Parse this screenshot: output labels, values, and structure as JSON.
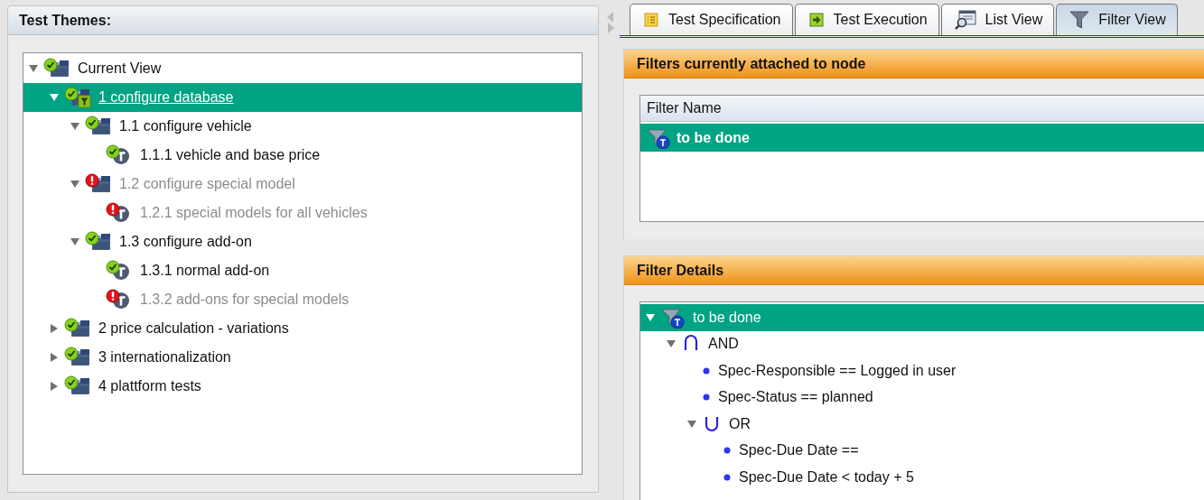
{
  "left_panel": {
    "title": "Test Themes:"
  },
  "theme_tree": [
    {
      "label": "Current View",
      "kind": "folder",
      "passed": true,
      "expanded": true,
      "selected": false,
      "disabled": false,
      "children": [
        {
          "label": "1 configure database",
          "kind": "filtered-folder",
          "passed": true,
          "expanded": true,
          "selected": true,
          "disabled": false,
          "children": [
            {
              "label": "1.1 configure vehicle",
              "kind": "folder",
              "passed": true,
              "expanded": true,
              "selected": false,
              "disabled": false,
              "children": [
                {
                  "label": "1.1.1 vehicle and base price",
                  "kind": "test",
                  "passed": true,
                  "selected": false,
                  "disabled": false
                }
              ]
            },
            {
              "label": "1.2 configure special model",
              "kind": "folder",
              "passed": false,
              "expanded": true,
              "selected": false,
              "disabled": true,
              "children": [
                {
                  "label": "1.2.1 special models for all vehicles",
                  "kind": "test",
                  "passed": false,
                  "selected": false,
                  "disabled": true
                }
              ]
            },
            {
              "label": "1.3 configure add-on",
              "kind": "folder",
              "passed": true,
              "expanded": true,
              "selected": false,
              "disabled": false,
              "children": [
                {
                  "label": "1.3.1 normal add-on",
                  "kind": "test",
                  "passed": true,
                  "selected": false,
                  "disabled": false
                },
                {
                  "label": "1.3.2 add-ons for special models",
                  "kind": "test",
                  "passed": false,
                  "selected": false,
                  "disabled": true
                }
              ]
            }
          ]
        },
        {
          "label": "2 price calculation - variations",
          "kind": "folder",
          "passed": true,
          "expanded": false,
          "selected": false,
          "disabled": false
        },
        {
          "label": "3 internationalization",
          "kind": "folder",
          "passed": true,
          "expanded": false,
          "selected": false,
          "disabled": false
        },
        {
          "label": "4 plattform tests",
          "kind": "folder",
          "passed": true,
          "expanded": false,
          "selected": false,
          "disabled": false
        }
      ]
    }
  ],
  "tabs": [
    {
      "label": "Test Specification",
      "kind": "list",
      "selected": false
    },
    {
      "label": "Test Execution",
      "kind": "execute",
      "selected": false
    },
    {
      "label": "List View",
      "kind": "search-window",
      "selected": false
    },
    {
      "label": "Filter View",
      "kind": "funnel",
      "selected": true
    }
  ],
  "attached_filters": {
    "title": "Filters currently attached to node",
    "columns": [
      "Filter Name"
    ],
    "rows": [
      {
        "name": "to be done",
        "selected": true
      }
    ]
  },
  "filter_details": {
    "title": "Filter Details",
    "tree": [
      {
        "label": "to be done",
        "kind": "filter",
        "expanded": true,
        "selected": true,
        "children": [
          {
            "label": "AND",
            "kind": "and",
            "expanded": true,
            "selected": false,
            "children": [
              {
                "label": "Spec-Responsible == Logged in user",
                "kind": "condition",
                "selected": false
              },
              {
                "label": "Spec-Status == planned",
                "kind": "condition",
                "selected": false
              },
              {
                "label": "OR",
                "kind": "or",
                "expanded": true,
                "selected": false,
                "children": [
                  {
                    "label": "Spec-Due Date ==",
                    "kind": "condition",
                    "selected": false
                  },
                  {
                    "label": "Spec-Due Date < today + 5",
                    "kind": "condition",
                    "selected": false
                  }
                ]
              }
            ]
          }
        ]
      }
    ]
  }
}
